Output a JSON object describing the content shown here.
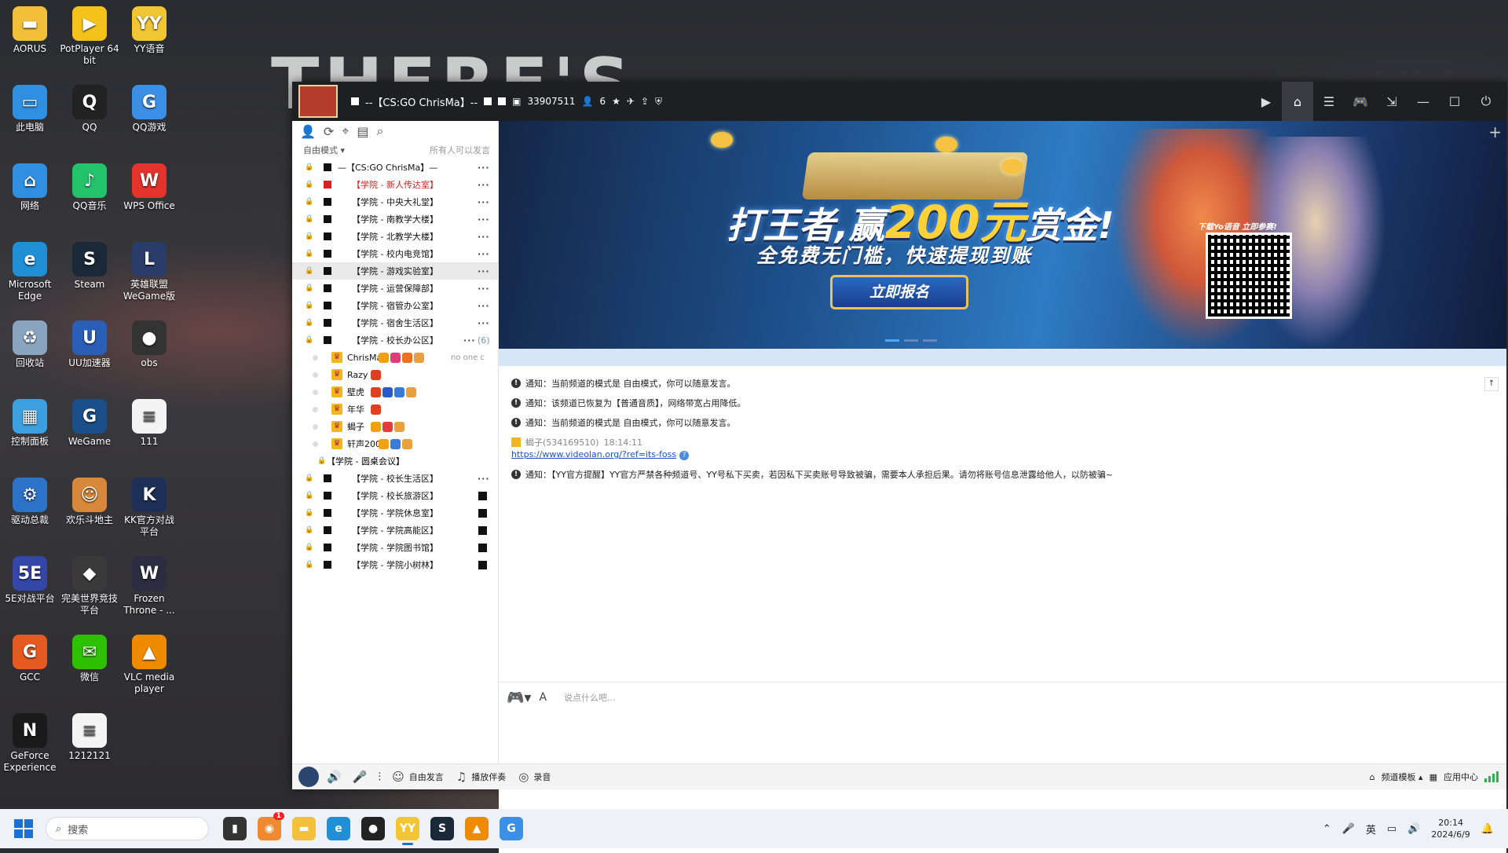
{
  "wallpaper": {
    "text": "THERE'S"
  },
  "desktop_icons": [
    {
      "label": "AORUS",
      "icon": "folder-icon",
      "color": "#f3c03a",
      "glyph": "▬"
    },
    {
      "label": "PotPlayer 64 bit",
      "icon": "potplayer-icon",
      "color": "#f5c21c",
      "glyph": "▶"
    },
    {
      "label": "YY语音",
      "icon": "yy-icon",
      "color": "#f2c535",
      "glyph": "YY"
    },
    {
      "label": "此电脑",
      "icon": "computer-icon",
      "color": "#2f8fe0",
      "glyph": "▭"
    },
    {
      "label": "QQ",
      "icon": "qq-penguin-icon",
      "color": "#222222",
      "glyph": "Q"
    },
    {
      "label": "QQ游戏",
      "icon": "qq-game-icon",
      "color": "#3b8fe5",
      "glyph": "G"
    },
    {
      "label": "网络",
      "icon": "network-icon",
      "color": "#2f8fe0",
      "glyph": "⌂"
    },
    {
      "label": "QQ音乐",
      "icon": "qq-music-icon",
      "color": "#22c36a",
      "glyph": "♪"
    },
    {
      "label": "WPS Office",
      "icon": "wps-icon",
      "color": "#e4322d",
      "glyph": "W"
    },
    {
      "label": "Microsoft Edge",
      "icon": "edge-icon",
      "color": "#1f8fd6",
      "glyph": "e"
    },
    {
      "label": "Steam",
      "icon": "steam-icon",
      "color": "#1b2838",
      "glyph": "S"
    },
    {
      "label": "英雄联盟 WeGame版",
      "icon": "lol-icon",
      "color": "#2a3d6a",
      "glyph": "L"
    },
    {
      "label": "回收站",
      "icon": "recycle-bin-icon",
      "color": "#8aa4c0",
      "glyph": "♻"
    },
    {
      "label": "UU加速器",
      "icon": "uu-icon",
      "color": "#2a5fb8",
      "glyph": "U"
    },
    {
      "label": "obs",
      "icon": "obs-icon",
      "color": "#333333",
      "glyph": "●"
    },
    {
      "label": "控制面板",
      "icon": "control-panel-icon",
      "color": "#3ca0e0",
      "glyph": "▦"
    },
    {
      "label": "WeGame",
      "icon": "wegame-icon",
      "color": "#1a4f8a",
      "glyph": "G"
    },
    {
      "label": "111",
      "icon": "document-icon",
      "color": "#f4f4f4",
      "glyph": "≡"
    },
    {
      "label": "驱动总裁",
      "icon": "driver-icon",
      "color": "#2b72c8",
      "glyph": "⚙"
    },
    {
      "label": "欢乐斗地主",
      "icon": "doudizhu-icon",
      "color": "#d8883a",
      "glyph": "☺"
    },
    {
      "label": "KK官方对战 平台",
      "icon": "kk-icon",
      "color": "#1d2f56",
      "glyph": "K"
    },
    {
      "label": "5E对战平台",
      "icon": "5e-icon",
      "color": "#3446a8",
      "glyph": "5E"
    },
    {
      "label": "完美世界竞技 平台",
      "icon": "perfect-world-icon",
      "color": "#3a3a3a",
      "glyph": "◆"
    },
    {
      "label": "Frozen Throne - ...",
      "icon": "warcraft-icon",
      "color": "#2c2c40",
      "glyph": "W"
    },
    {
      "label": "GCC",
      "icon": "gcc-icon",
      "color": "#e45a20",
      "glyph": "G"
    },
    {
      "label": "微信",
      "icon": "wechat-icon",
      "color": "#2dc100",
      "glyph": "✉"
    },
    {
      "label": "VLC media player",
      "icon": "vlc-icon",
      "color": "#f08a00",
      "glyph": "▲"
    },
    {
      "label": "GeForce Experience",
      "icon": "nvidia-icon",
      "color": "#1a1a1a",
      "glyph": "N"
    },
    {
      "label": "1212121",
      "icon": "document-icon",
      "color": "#f4f4f4",
      "glyph": "≡"
    }
  ],
  "window": {
    "channel_title": "--【CS:GO ChrisMa】--",
    "channel_id": "33907511",
    "online_count": "6"
  },
  "left_panel": {
    "mode": "自由模式",
    "mode_right": "所有人可以发言",
    "channels_top": [
      {
        "name": "—【CS:GO  ChrisMa】—",
        "red": false,
        "blk": "black",
        "suffix": "dots",
        "indent": true
      },
      {
        "name": "【学院 - 新人传达室】",
        "red": true,
        "blk": "red",
        "suffix": "dots"
      },
      {
        "name": "【学院 - 中央大礼堂】",
        "red": false,
        "blk": "black",
        "suffix": "dots"
      },
      {
        "name": "【学院 - 南教学大楼】",
        "red": false,
        "blk": "black",
        "suffix": "dots"
      },
      {
        "name": "【学院 - 北教学大楼】",
        "red": false,
        "blk": "black",
        "suffix": "dots"
      },
      {
        "name": "【学院 - 校内电竞馆】",
        "red": false,
        "blk": "black",
        "suffix": "dots"
      },
      {
        "name": "【学院 - 游戏实验室】",
        "red": false,
        "blk": "black",
        "suffix": "dots",
        "selected": true
      },
      {
        "name": "【学院 - 运营保障部】",
        "red": false,
        "blk": "black",
        "suffix": "dots"
      },
      {
        "name": "【学院 - 宿管办公室】",
        "red": false,
        "blk": "black",
        "suffix": "dots"
      },
      {
        "name": "【学院 - 宿舍生活区】",
        "red": false,
        "blk": "black",
        "suffix": "dots"
      },
      {
        "name": "【学院 - 校长办公区】",
        "red": false,
        "blk": "black",
        "suffix": "count",
        "count": "(6)"
      }
    ],
    "users": [
      {
        "name": "ChrisMa",
        "sig": "no one c",
        "badges": [
          "#f0a010",
          "#e23b7a",
          "#f07020",
          "#e8a040"
        ]
      },
      {
        "name": "Razy",
        "sig": "",
        "badges": [
          "#e04020"
        ]
      },
      {
        "name": "壁虎",
        "sig": "",
        "badges": [
          "#e04020",
          "#2a5ac8",
          "#3a7ad8",
          "#e8a040"
        ]
      },
      {
        "name": "年华",
        "sig": "",
        "badges": [
          "#e04020"
        ]
      },
      {
        "name": "蝎子",
        "sig": "",
        "badges": [
          "#f0a010",
          "#e23b3b",
          "#e8a040"
        ]
      },
      {
        "name": "轩声2009",
        "sig": "",
        "badges": [
          "#f0a010",
          "#3a7ad8",
          "#e8a040"
        ]
      }
    ],
    "subchannel": "【学院 - 圆桌会议】",
    "channels_bottom": [
      {
        "name": "【学院 - 校长生活区】",
        "suffix": "dots"
      },
      {
        "name": "【学院 - 校长旅游区】",
        "suffix": "block"
      },
      {
        "name": "【学院 - 学院休息室】",
        "suffix": "block"
      },
      {
        "name": "【学院 - 学院高能区】",
        "suffix": "block"
      },
      {
        "name": "【学院 - 学院图书馆】",
        "suffix": "block"
      },
      {
        "name": "【学院 - 学院小树林】",
        "suffix": "block"
      }
    ]
  },
  "banner": {
    "title_a": "打王者,赢",
    "title_b": "200元",
    "title_c": "赏金!",
    "subtitle": "全免费无门槛，快速提现到账",
    "button": "立即报名",
    "qr_caption": "下载Yo语音 立即参赛!"
  },
  "chat": {
    "messages": [
      {
        "type": "notice",
        "text": "通知：当前频道的模式是 自由模式，你可以随意发言。"
      },
      {
        "type": "notice",
        "text": "通知：该频道已恢复为【普通音质】，网络带宽占用降低。"
      },
      {
        "type": "notice",
        "text": "通知：当前频道的模式是 自由模式，你可以随意发言。"
      },
      {
        "type": "user",
        "sender": "蝎子(534169510)",
        "time": "18:14:11",
        "link": "https://www.videolan.org/?ref=its-foss"
      },
      {
        "type": "notice",
        "text": "通知：【YY官方提醒】YY官方严禁各种频道号、YY号私下买卖，若因私下买卖账号导致被骗，需要本人承担后果。请勿将账号信息泄露给他人，以防被骗~"
      }
    ],
    "input_placeholder": "说点什么吧..."
  },
  "bottom_bar": {
    "free_speech": "自由发言",
    "play_music": "播放伴奏",
    "record": "录音",
    "channel_template": "频道模板",
    "app_center": "应用中心"
  },
  "taskbar": {
    "search_placeholder": "搜索",
    "ime": "英",
    "time": "20:14",
    "date": "2024/6/9",
    "notification_badge": "1"
  }
}
